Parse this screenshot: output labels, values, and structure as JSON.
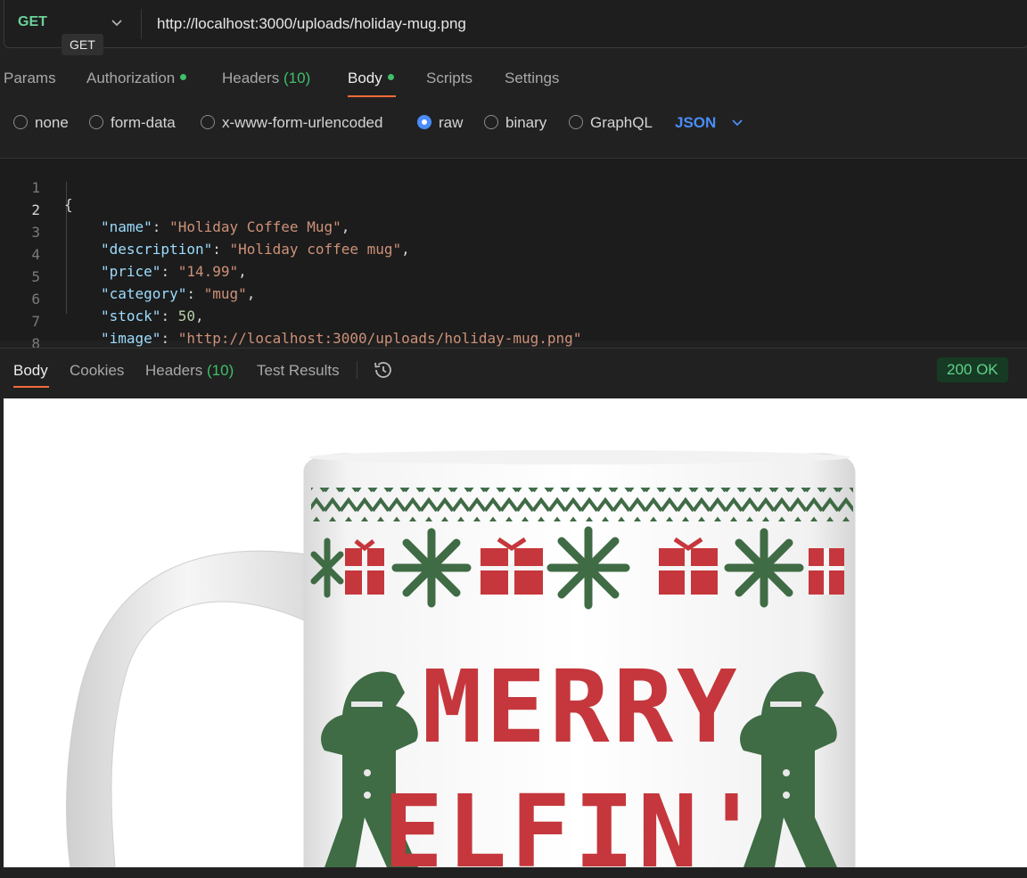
{
  "request": {
    "method": "GET",
    "url": "http://localhost:3000/uploads/holiday-mug.png",
    "tooltip": "GET"
  },
  "request_tabs": [
    {
      "label": "Params"
    },
    {
      "label": "Authorization"
    },
    {
      "label": "Headers",
      "count": "(10)"
    },
    {
      "label": "Body"
    },
    {
      "label": "Scripts"
    },
    {
      "label": "Settings"
    }
  ],
  "body_modes": {
    "options": [
      "none",
      "form-data",
      "x-www-form-urlencoded",
      "raw",
      "binary",
      "GraphQL"
    ],
    "selected": "raw",
    "format": "JSON"
  },
  "editor": {
    "line_numbers": [
      "1",
      "2",
      "3",
      "4",
      "5",
      "6",
      "7",
      "8"
    ],
    "open_brace": "{",
    "close_brace": "}",
    "fields": [
      {
        "key": "\"name\"",
        "value": "\"Holiday Coffee Mug\"",
        "comma": ","
      },
      {
        "key": "\"description\"",
        "value": "\"Holiday coffee mug\"",
        "comma": ","
      },
      {
        "key": "\"price\"",
        "value": "\"14.99\"",
        "comma": ","
      },
      {
        "key": "\"category\"",
        "value": "\"mug\"",
        "comma": ","
      },
      {
        "key": "\"stock\"",
        "value": "50",
        "comma": ","
      },
      {
        "key": "\"image\"",
        "value": "\"http://localhost:3000/uploads/holiday-mug.png\"",
        "comma": ""
      }
    ]
  },
  "response_tabs": [
    {
      "label": "Body"
    },
    {
      "label": "Cookies"
    },
    {
      "label": "Headers",
      "count": "(10)"
    },
    {
      "label": "Test Results"
    }
  ],
  "status": "200 OK",
  "preview": {
    "mug_text_line1": "MERRY",
    "mug_text_line2": "ELFIN'"
  },
  "colors": {
    "accent_orange": "#f26b3a",
    "method_green": "#6bd19a",
    "link_blue": "#4a8df8",
    "knit_red": "#c5373c",
    "knit_green": "#3f6b45"
  },
  "icons": [
    "chevron-down-icon",
    "history-icon",
    "radio-icon"
  ]
}
